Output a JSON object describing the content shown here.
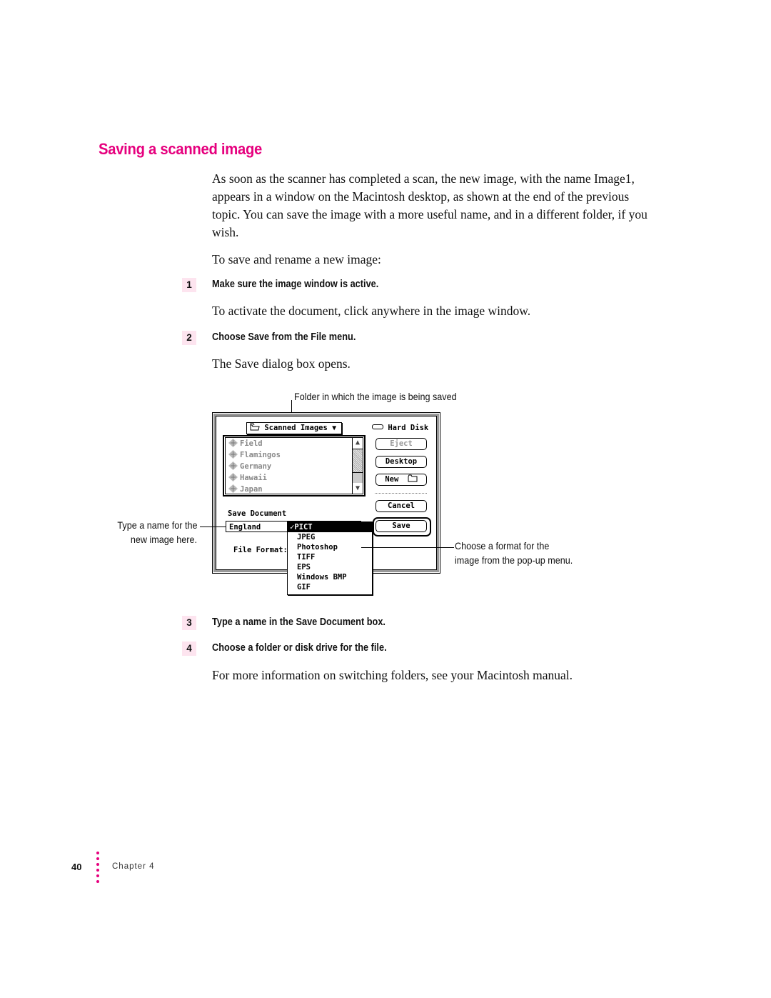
{
  "section": {
    "heading": "Saving a scanned image",
    "intro": "As soon as the scanner has completed a scan, the new image, with the name Image1, appears in a window on the Macintosh desktop, as shown at the end of the previous topic. You can save the image with a more useful name, and in a different folder, if you wish.",
    "lead_in": "To save and rename a new image:"
  },
  "steps": [
    {
      "number": "1",
      "text": "Make sure the image window is active.",
      "detail": "To activate the document, click anywhere in the image window."
    },
    {
      "number": "2",
      "text": "Choose Save from the File menu.",
      "detail": "The Save dialog box opens."
    },
    {
      "number": "3",
      "text": "Type a name in the Save Document box.",
      "detail": ""
    },
    {
      "number": "4",
      "text": "Choose a folder or disk drive for the file.",
      "detail": "For more information on switching folders, see your Macintosh manual."
    }
  ],
  "callouts": {
    "folder": "Folder in which the image is being saved",
    "name_line1": "Type a name for the",
    "name_line2": "new image here.",
    "format_line1": "Choose a format for the",
    "format_line2": "image from the pop-up menu."
  },
  "dialog": {
    "folder_popup": "Scanned Images",
    "disk_name": "Hard Disk",
    "files": [
      "Field",
      "Flamingos",
      "Germany",
      "Hawaii",
      "Japan"
    ],
    "buttons": {
      "eject": "Eject",
      "desktop": "Desktop",
      "new": "New",
      "cancel": "Cancel",
      "save": "Save"
    },
    "save_label": "Save Document",
    "name_value": "England",
    "format_label": "File Format:",
    "format_options": [
      "PICT",
      "JPEG",
      "Photoshop",
      "TIFF",
      "EPS",
      "Windows BMP",
      "GIF"
    ],
    "selected_format": "PICT",
    "check_mark": "✓"
  },
  "footer": {
    "page_number": "40",
    "chapter": "Chapter 4"
  },
  "colors": {
    "accent": "#e6007e",
    "step_badge": "#fde4ef"
  }
}
